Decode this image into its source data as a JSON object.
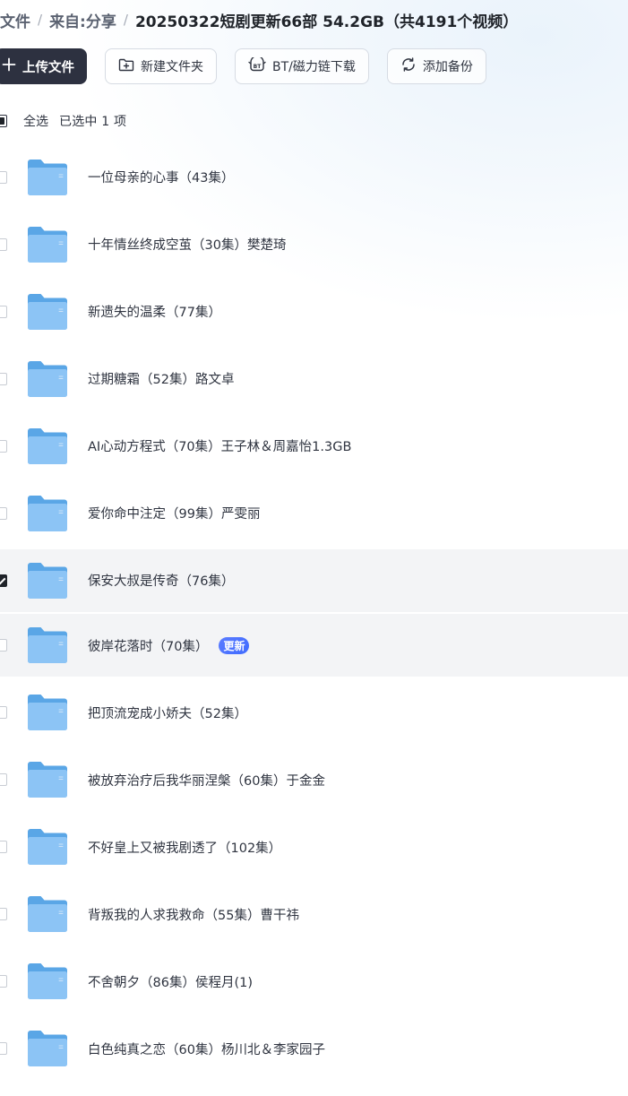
{
  "breadcrumb": {
    "root": "文件",
    "source_label": "来自:",
    "source": "分享",
    "current": "20250322短剧更新66部 54.2GB（共4191个视频）"
  },
  "toolbar": {
    "upload": "上传文件",
    "new_folder": "新建文件夹",
    "bt": "BT/磁力链下载",
    "backup": "添加备份"
  },
  "selection": {
    "select_all": "全选",
    "selected_text": "已选中  1  项"
  },
  "files": [
    {
      "name": "一位母亲的心事（43集）",
      "checked": false,
      "highlighted": false,
      "badge": ""
    },
    {
      "name": "十年情丝终成空茧（30集）樊楚琦",
      "checked": false,
      "highlighted": false,
      "badge": ""
    },
    {
      "name": "新遗失的温柔（77集）",
      "checked": false,
      "highlighted": false,
      "badge": ""
    },
    {
      "name": "过期糖霜（52集）路文卓",
      "checked": false,
      "highlighted": false,
      "badge": ""
    },
    {
      "name": "AI心动方程式（70集）王子林＆周嘉怡1.3GB",
      "checked": false,
      "highlighted": false,
      "badge": ""
    },
    {
      "name": "爱你命中注定（99集）严雯丽",
      "checked": false,
      "highlighted": false,
      "badge": ""
    },
    {
      "name": "保安大叔是传奇（76集）",
      "checked": true,
      "highlighted": true,
      "badge": ""
    },
    {
      "name": "彼岸花落时（70集）",
      "checked": false,
      "highlighted": true,
      "badge": "更新"
    },
    {
      "name": "把顶流宠成小娇夫（52集）",
      "checked": false,
      "highlighted": false,
      "badge": ""
    },
    {
      "name": "被放弃治疗后我华丽涅槃（60集）于金金",
      "checked": false,
      "highlighted": false,
      "badge": ""
    },
    {
      "name": "不好皇上又被我剧透了（102集）",
      "checked": false,
      "highlighted": false,
      "badge": ""
    },
    {
      "name": "背叛我的人求我救命（55集）曹干祎",
      "checked": false,
      "highlighted": false,
      "badge": ""
    },
    {
      "name": "不舍朝夕（86集）侯程月(1)",
      "checked": false,
      "highlighted": false,
      "badge": ""
    },
    {
      "name": "白色纯真之恋（60集）杨川北＆李家园子",
      "checked": false,
      "highlighted": false,
      "badge": ""
    }
  ],
  "colors": {
    "primary_button": "#2d3140",
    "folder_back": "#5aa6e6",
    "folder_front": "#8cc4f5",
    "badge": "#4a72ff",
    "row_highlight": "#f3f4f6"
  }
}
